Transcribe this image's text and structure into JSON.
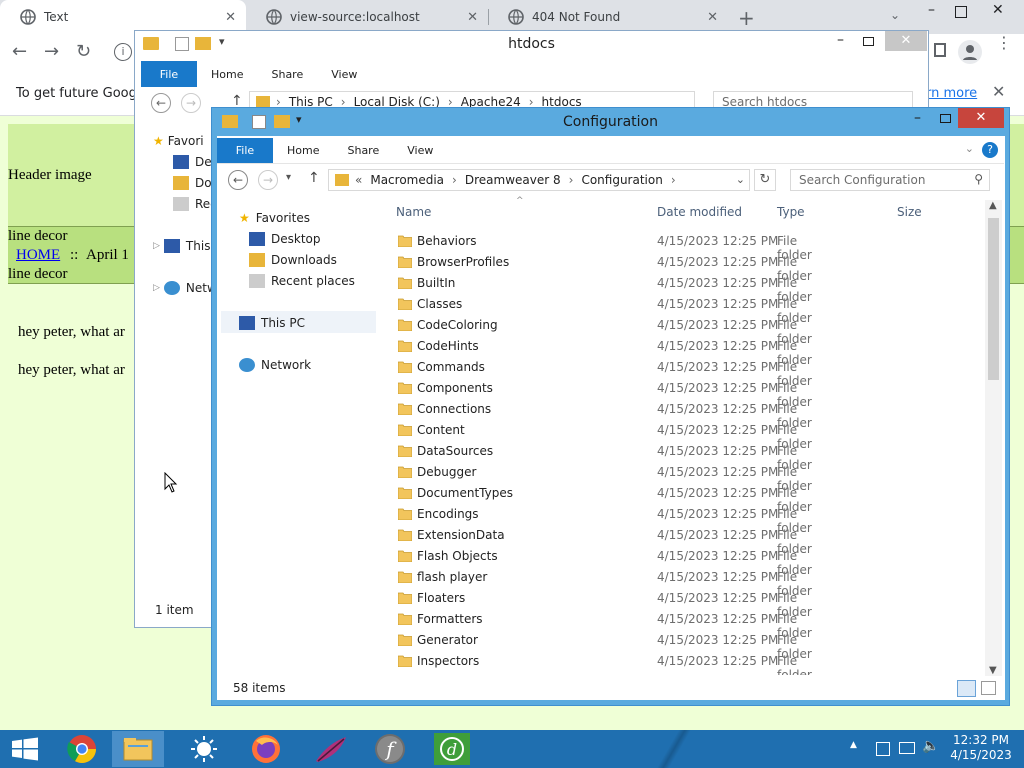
{
  "chrome": {
    "tabs": [
      {
        "title": "Text",
        "active": true
      },
      {
        "title": "view-source:localhost",
        "active": false
      },
      {
        "title": "404 Not Found",
        "active": false
      }
    ],
    "new_tab_icon": "plus-icon",
    "infobar": {
      "text": "To get future Google",
      "link": "rn more"
    }
  },
  "webpage": {
    "header_image_alt": "Header image",
    "line_decor_alt_1": "line decor",
    "line_decor_alt_2": "line decor",
    "home_link": "HOME",
    "separator": "::",
    "date_text": "April 1",
    "message_1": "hey peter, what ar",
    "message_2": "hey peter, what ar"
  },
  "htdocs_window": {
    "title": "htdocs",
    "ribbon": {
      "file": "File",
      "home": "Home",
      "share": "Share",
      "view": "View"
    },
    "breadcrumb": [
      "This PC",
      "Local Disk (C:)",
      "Apache24",
      "htdocs"
    ],
    "search_placeholder": "Search htdocs",
    "nav": {
      "favorites": "Favori",
      "desktop": "Des",
      "downloads": "Dov",
      "recent": "Rec",
      "this_pc": "This P",
      "network": "Netw"
    },
    "status": "1 item"
  },
  "config_window": {
    "title": "Configuration",
    "ribbon": {
      "file": "File",
      "home": "Home",
      "share": "Share",
      "view": "View"
    },
    "breadcrumb_prefix": "«",
    "breadcrumb": [
      "Macromedia",
      "Dreamweaver 8",
      "Configuration"
    ],
    "search_placeholder": "Search Configuration",
    "nav": {
      "favorites": "Favorites",
      "desktop": "Desktop",
      "downloads": "Downloads",
      "recent": "Recent places",
      "this_pc": "This PC",
      "network": "Network"
    },
    "columns": {
      "name": "Name",
      "date": "Date modified",
      "type": "Type",
      "size": "Size"
    },
    "files": [
      {
        "name": "Behaviors",
        "date": "4/15/2023 12:25 PM",
        "type": "File folder"
      },
      {
        "name": "BrowserProfiles",
        "date": "4/15/2023 12:25 PM",
        "type": "File folder"
      },
      {
        "name": "BuiltIn",
        "date": "4/15/2023 12:25 PM",
        "type": "File folder"
      },
      {
        "name": "Classes",
        "date": "4/15/2023 12:25 PM",
        "type": "File folder"
      },
      {
        "name": "CodeColoring",
        "date": "4/15/2023 12:25 PM",
        "type": "File folder"
      },
      {
        "name": "CodeHints",
        "date": "4/15/2023 12:25 PM",
        "type": "File folder"
      },
      {
        "name": "Commands",
        "date": "4/15/2023 12:25 PM",
        "type": "File folder"
      },
      {
        "name": "Components",
        "date": "4/15/2023 12:25 PM",
        "type": "File folder"
      },
      {
        "name": "Connections",
        "date": "4/15/2023 12:25 PM",
        "type": "File folder"
      },
      {
        "name": "Content",
        "date": "4/15/2023 12:25 PM",
        "type": "File folder"
      },
      {
        "name": "DataSources",
        "date": "4/15/2023 12:25 PM",
        "type": "File folder"
      },
      {
        "name": "Debugger",
        "date": "4/15/2023 12:25 PM",
        "type": "File folder"
      },
      {
        "name": "DocumentTypes",
        "date": "4/15/2023 12:25 PM",
        "type": "File folder"
      },
      {
        "name": "Encodings",
        "date": "4/15/2023 12:25 PM",
        "type": "File folder"
      },
      {
        "name": "ExtensionData",
        "date": "4/15/2023 12:25 PM",
        "type": "File folder"
      },
      {
        "name": "Flash Objects",
        "date": "4/15/2023 12:25 PM",
        "type": "File folder"
      },
      {
        "name": "flash player",
        "date": "4/15/2023 12:25 PM",
        "type": "File folder"
      },
      {
        "name": "Floaters",
        "date": "4/15/2023 12:25 PM",
        "type": "File folder"
      },
      {
        "name": "Formatters",
        "date": "4/15/2023 12:25 PM",
        "type": "File folder"
      },
      {
        "name": "Generator",
        "date": "4/15/2023 12:25 PM",
        "type": "File folder"
      },
      {
        "name": "Inspectors",
        "date": "4/15/2023 12:25 PM",
        "type": "File folder"
      }
    ],
    "status": "58 items"
  },
  "taskbar": {
    "time": "12:32 PM",
    "date": "4/15/2023",
    "icons": [
      "windows-start-icon",
      "chrome-icon",
      "file-explorer-icon",
      "weather-icon",
      "firefox-icon",
      "feather-icon",
      "flash-icon",
      "dreamweaver-icon"
    ]
  }
}
